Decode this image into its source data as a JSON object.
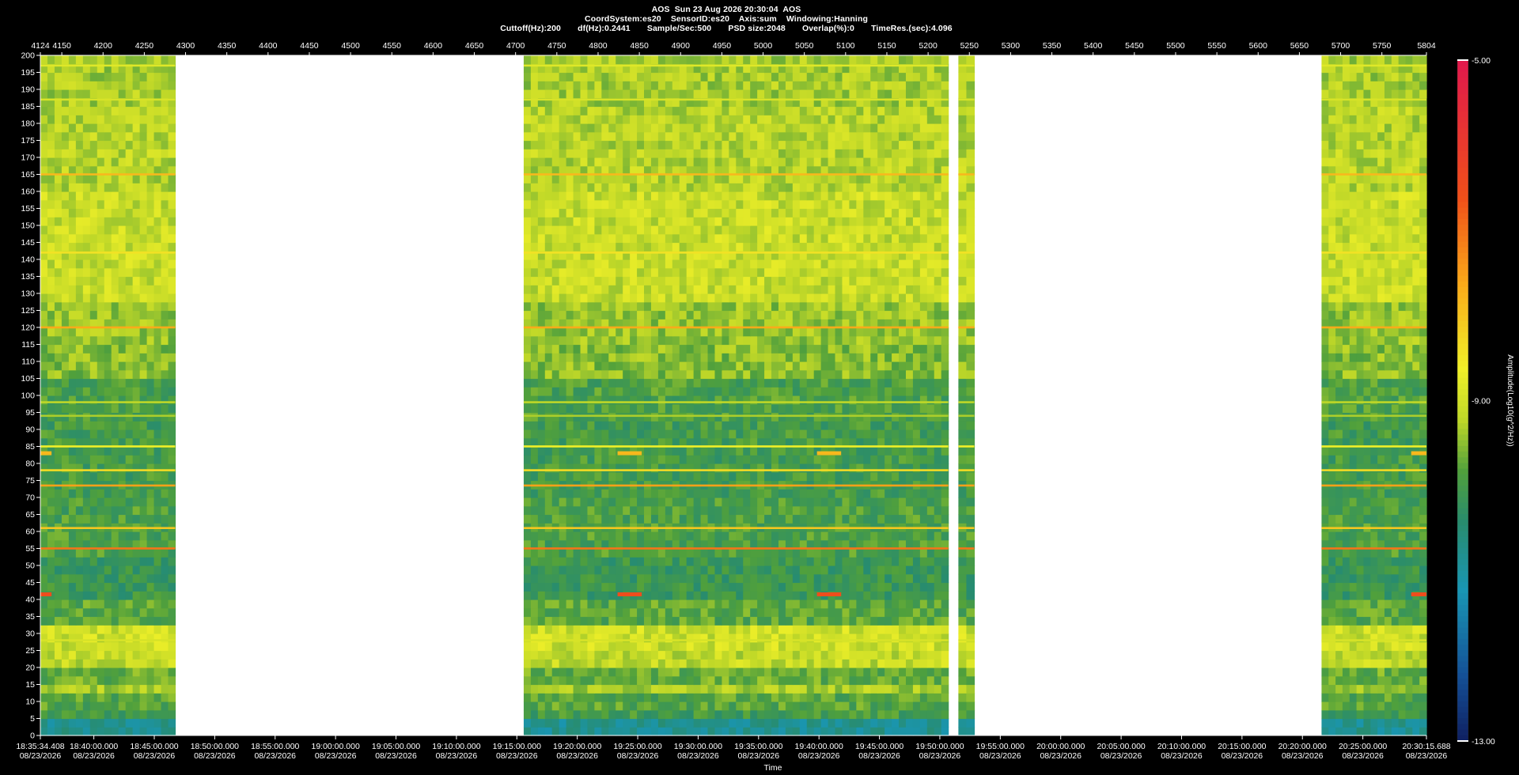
{
  "header": {
    "line1": "AOS  Sun 23 Aug 2026 20:30:04  AOS",
    "line2": "CoordSystem:es20    SensorID:es20    Axis:sum    Windowing:Hanning",
    "line3": "Cuttoff(Hz):200       df(Hz):0.2441       Sample/Sec:500       PSD size:2048       Overlap(%):0       TimeRes.(sec):4.096"
  },
  "chart_data": {
    "type": "heatmap",
    "title": "",
    "xlabel": "Time",
    "ylabel": "",
    "colorbar_label": "Amplitude(Log10(g^2/Hz))",
    "colorbar_ticks": [
      "-5.00",
      "-9.00",
      "-13.00"
    ],
    "colorbar_range": [
      -13,
      -5
    ],
    "ylim": [
      0,
      200
    ],
    "y_ticks": [
      200,
      195,
      190,
      185,
      180,
      175,
      170,
      165,
      160,
      155,
      150,
      145,
      140,
      135,
      130,
      125,
      120,
      115,
      110,
      105,
      100,
      95,
      90,
      85,
      80,
      75,
      70,
      65,
      60,
      55,
      50,
      45,
      40,
      35,
      30,
      25,
      20,
      15,
      10,
      5,
      0
    ],
    "top_axis_range": [
      4124,
      5804
    ],
    "top_ticks": [
      "4124",
      "4150",
      "4200",
      "4250",
      "4300",
      "4350",
      "4400",
      "4450",
      "4500",
      "4550",
      "4600",
      "4650",
      "4700",
      "4750",
      "4800",
      "4850",
      "4900",
      "4950",
      "5000",
      "5050",
      "5100",
      "5150",
      "5200",
      "5250",
      "5300",
      "5350",
      "5400",
      "5450",
      "5500",
      "5550",
      "5600",
      "5650",
      "5700",
      "5750",
      "5804"
    ],
    "time_start": "18:35:34.408",
    "time_end": "20:30:15.688",
    "time_ticks": [
      {
        "time": "18:35:34.408",
        "date": "08/23/2026"
      },
      {
        "time": "18:40:00.000",
        "date": "08/23/2026"
      },
      {
        "time": "18:45:00.000",
        "date": "08/23/2026"
      },
      {
        "time": "18:50:00.000",
        "date": "08/23/2026"
      },
      {
        "time": "18:55:00.000",
        "date": "08/23/2026"
      },
      {
        "time": "19:00:00.000",
        "date": "08/23/2026"
      },
      {
        "time": "19:05:00.000",
        "date": "08/23/2026"
      },
      {
        "time": "19:10:00.000",
        "date": "08/23/2026"
      },
      {
        "time": "19:15:00.000",
        "date": "08/23/2026"
      },
      {
        "time": "19:20:00.000",
        "date": "08/23/2026"
      },
      {
        "time": "19:25:00.000",
        "date": "08/23/2026"
      },
      {
        "time": "19:30:00.000",
        "date": "08/23/2026"
      },
      {
        "time": "19:35:00.000",
        "date": "08/23/2026"
      },
      {
        "time": "19:40:00.000",
        "date": "08/23/2026"
      },
      {
        "time": "19:45:00.000",
        "date": "08/23/2026"
      },
      {
        "time": "19:50:00.000",
        "date": "08/23/2026"
      },
      {
        "time": "19:55:00.000",
        "date": "08/23/2026"
      },
      {
        "time": "20:00:00.000",
        "date": "08/23/2026"
      },
      {
        "time": "20:05:00.000",
        "date": "08/23/2026"
      },
      {
        "time": "20:10:00.000",
        "date": "08/23/2026"
      },
      {
        "time": "20:15:00.000",
        "date": "08/23/2026"
      },
      {
        "time": "20:20:00.000",
        "date": "08/23/2026"
      },
      {
        "time": "20:25:00.000",
        "date": "08/23/2026"
      },
      {
        "time": "20:30:15.688",
        "date": "08/23/2026"
      }
    ],
    "data_segments": [
      {
        "start": "18:35:34.408",
        "end": "18:46:44"
      },
      {
        "start": "19:15:34",
        "end": "19:50:42"
      },
      {
        "start": "19:51:32",
        "end": "19:52:51"
      },
      {
        "start": "20:21:35",
        "end": "20:30:15.688"
      }
    ],
    "persistent_lines_hz": [
      {
        "hz": 197,
        "level": -8.8
      },
      {
        "hz": 187,
        "level": -8.9
      },
      {
        "hz": 165,
        "level": -7.8
      },
      {
        "hz": 142,
        "level": -8.4
      },
      {
        "hz": 120,
        "level": -7.6
      },
      {
        "hz": 98,
        "level": -9.2
      },
      {
        "hz": 94,
        "level": -9.3
      },
      {
        "hz": 85,
        "level": -8.6
      },
      {
        "hz": 78,
        "level": -8.3
      },
      {
        "hz": 73.5,
        "level": -7.5
      },
      {
        "hz": 61,
        "level": -8.0
      },
      {
        "hz": 55,
        "level": -7.0
      },
      {
        "hz": 28,
        "level": -8.9
      }
    ],
    "intermittent_lines_hz": [
      {
        "hz": 83,
        "level": -7.8,
        "start": "18:35:34.408",
        "end": "18:36:30"
      },
      {
        "hz": 41.5,
        "level": -6.5,
        "start": "18:35:34.408",
        "end": "18:36:30"
      },
      {
        "hz": 83,
        "level": -7.8,
        "start": "19:23:20",
        "end": "19:25:20"
      },
      {
        "hz": 41.5,
        "level": -6.5,
        "start": "19:23:20",
        "end": "19:25:20"
      },
      {
        "hz": 83,
        "level": -7.8,
        "start": "19:39:50",
        "end": "19:41:50"
      },
      {
        "hz": 41.5,
        "level": -6.5,
        "start": "19:39:50",
        "end": "19:41:50"
      },
      {
        "hz": 83,
        "level": -7.8,
        "start": "20:29:00",
        "end": "20:30:15.688"
      },
      {
        "hz": 41.5,
        "level": -6.5,
        "start": "20:29:00",
        "end": "20:30:15.688"
      }
    ]
  }
}
